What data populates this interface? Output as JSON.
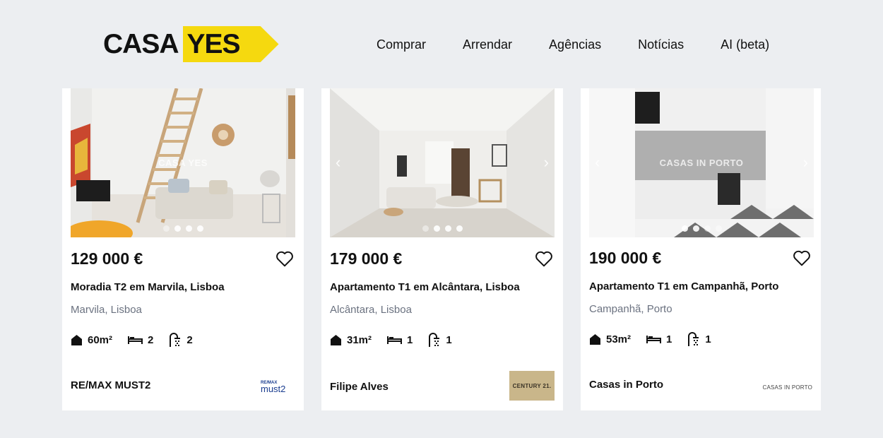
{
  "brand": {
    "casa": "CASA",
    "yes": "YES"
  },
  "nav": [
    "Comprar",
    "Arrendar",
    "Agências",
    "Notícias",
    "AI (beta)"
  ],
  "listings": [
    {
      "price": "129 000 €",
      "title": "Moradia T2 em Marvila, Lisboa",
      "location": "Marvila, Lisboa",
      "area": "60m²",
      "bedrooms": "2",
      "bathrooms": "2",
      "agency": "RE/MAX MUST2",
      "agency_logo_text": "RE/MAX must2",
      "watermark": "CASA YES",
      "image_subject": "living-room-with-wooden-stairs"
    },
    {
      "price": "179 000 €",
      "title": "Apartamento T1 em Alcântara, Lisboa",
      "location": "Alcântara, Lisboa",
      "area": "31m²",
      "bedrooms": "1",
      "bathrooms": "1",
      "agency": "Filipe Alves",
      "agency_logo_text": "CENTURY 21.",
      "watermark": "",
      "image_subject": "bright-living-room"
    },
    {
      "price": "190 000 €",
      "title": "Apartamento T1 em Campanhã, Porto",
      "location": "Campanhã, Porto",
      "area": "53m²",
      "bedrooms": "1",
      "bathrooms": "1",
      "agency": "Casas in Porto",
      "agency_logo_text": "CASAS IN PORTO",
      "watermark": "CASAS IN PORTO",
      "image_subject": "white-kitchen-patterned-floor"
    }
  ],
  "colors": {
    "brand_yellow": "#f5d90f",
    "background": "#eceef1",
    "muted_text": "#6b7280"
  },
  "icons": {
    "favorite": "heart-outline-icon",
    "area": "house-icon",
    "bedrooms": "bed-icon",
    "bathrooms": "shower-icon"
  }
}
